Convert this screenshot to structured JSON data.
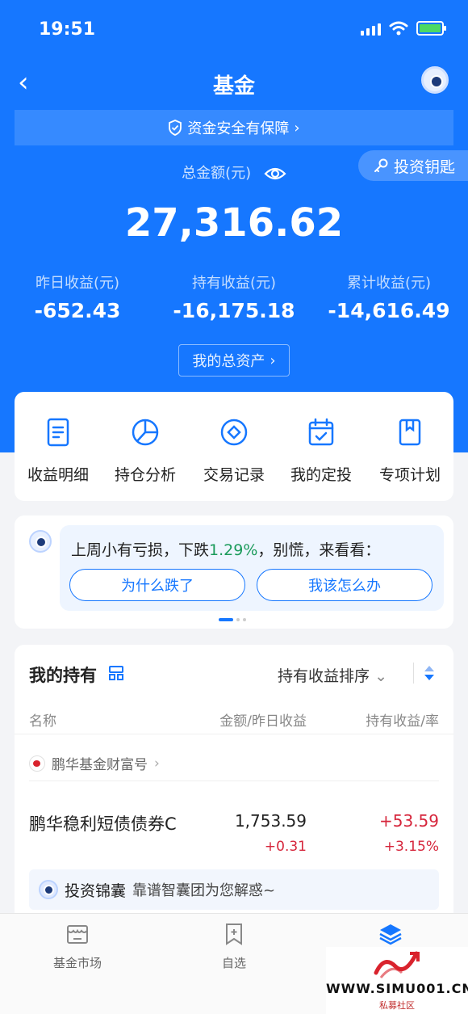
{
  "status_bar": {
    "time": "19:51"
  },
  "nav": {
    "title": "基金"
  },
  "security_banner": {
    "text": "资金安全有保障"
  },
  "invest_key": {
    "label": "投资钥匙"
  },
  "summary": {
    "total_label": "总金额(元)",
    "total_amount": "27,316.62",
    "stats": [
      {
        "label": "昨日收益(元)",
        "value": "-652.43"
      },
      {
        "label": "持有收益(元)",
        "value": "-16,175.18"
      },
      {
        "label": "累计收益(元)",
        "value": "-14,616.49"
      }
    ],
    "assets_button": "我的总资产"
  },
  "quick_actions": [
    {
      "label": "收益明细",
      "icon": "document-icon"
    },
    {
      "label": "持仓分析",
      "icon": "pie-chart-icon"
    },
    {
      "label": "交易记录",
      "icon": "record-icon"
    },
    {
      "label": "我的定投",
      "icon": "calendar-icon"
    },
    {
      "label": "专项计划",
      "icon": "bookmark-icon"
    }
  ],
  "tip": {
    "text_before": "上周小有亏损，下跌",
    "pct": "1.29%",
    "text_after": "，别慌，来看看：",
    "btn_why": "为什么跌了",
    "btn_what": "我该怎么办"
  },
  "holdings": {
    "title": "我的持有",
    "sort_label": "持有收益排序",
    "col_name": "名称",
    "col_amount": "金额/昨日收益",
    "col_gain": "持有收益/率",
    "company": "鹏华基金财富号",
    "fund": {
      "name": "鹏华稳利短债债券C",
      "amount": "1,753.59",
      "yesterday": "+0.31",
      "gain": "+53.59",
      "rate": "+3.15%"
    },
    "bag_title": "投资锦囊",
    "bag_desc": "靠谱智囊团为您解惑~"
  },
  "tabbar": [
    {
      "label": "基金市场",
      "icon": "store-icon"
    },
    {
      "label": "自选",
      "icon": "add-favorite-icon"
    },
    {
      "label": "",
      "icon": "layers-icon"
    }
  ],
  "watermark": {
    "url": "WWW.SIMU001.CN",
    "sub": "私募社区"
  },
  "colors": {
    "primary": "#1677ff",
    "loss_green": "#1a9a5a",
    "gain_red": "#d6263c"
  }
}
